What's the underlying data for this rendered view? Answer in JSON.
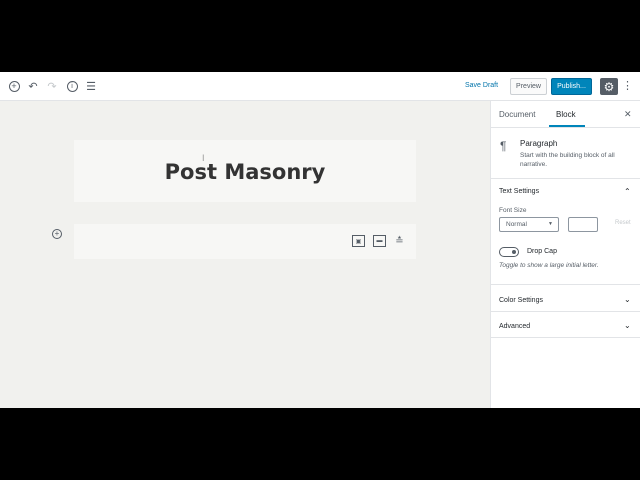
{
  "toolbar": {
    "add_icon": "plus-circle-icon",
    "undo_icon": "undo-icon",
    "redo_icon": "redo-icon",
    "info_icon": "info-icon",
    "outline_icon": "list-icon",
    "save_draft": "Save Draft",
    "preview": "Preview",
    "publish": "Publish...",
    "settings_icon": "gear-icon",
    "more_icon": "vertical-dots-icon",
    "accent_color": "#0085ba"
  },
  "editor": {
    "post_title": "Post Masonry",
    "cursor_glyph": "I",
    "block_toolbar_icons": [
      "media-text-icon",
      "wide-align-icon",
      "align-center-icon"
    ]
  },
  "sidebar": {
    "tabs": [
      "Document",
      "Block"
    ],
    "active_tab": "Block",
    "block": {
      "name": "Paragraph",
      "description": "Start with the building block of all narrative."
    },
    "text_settings": {
      "title": "Text Settings",
      "font_size_label": "Font Size",
      "font_size_value": "Normal",
      "reset_label": "Reset",
      "drop_cap_label": "Drop Cap",
      "drop_cap_help": "Toggle to show a large initial letter."
    },
    "color_settings": {
      "title": "Color Settings"
    },
    "advanced": {
      "title": "Advanced"
    }
  }
}
